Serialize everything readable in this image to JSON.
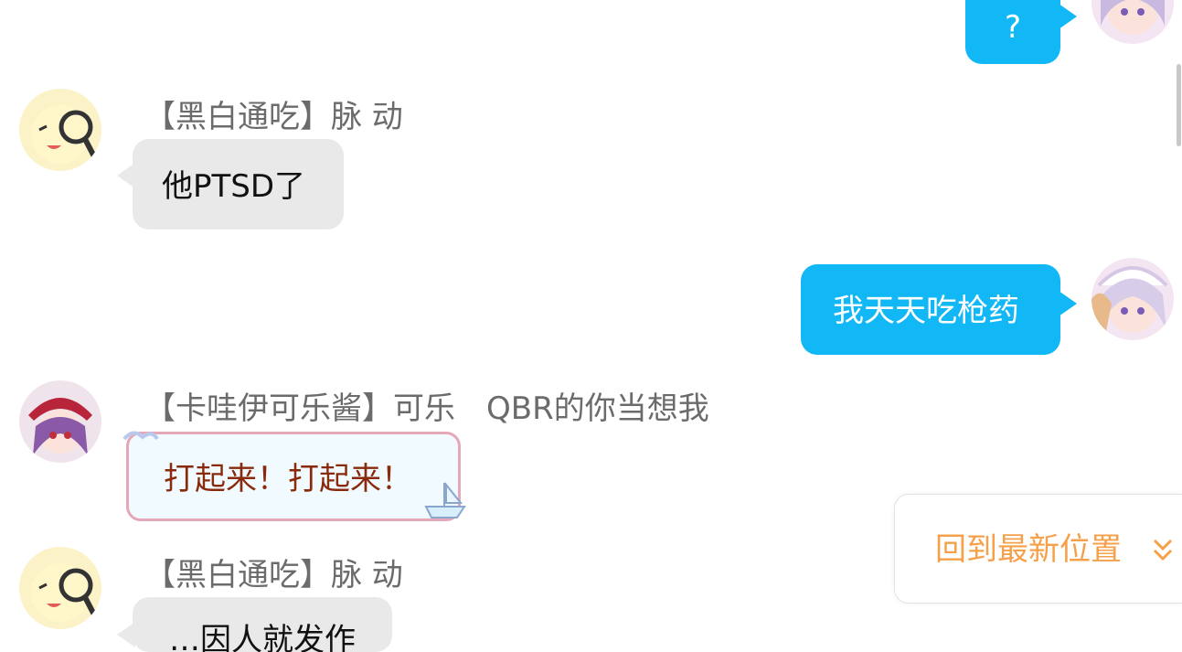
{
  "messages": [
    {
      "side": "right",
      "text": "?"
    },
    {
      "side": "left",
      "sender": "【黑白通吃】脉 动",
      "text": "他PTSD了"
    },
    {
      "side": "right",
      "text": "我天天吃枪药"
    },
    {
      "side": "left",
      "sender": "【卡哇伊可乐酱】可乐　QBR的你当想我",
      "text": "打起来！打起来！"
    },
    {
      "side": "left",
      "sender": "【黑白通吃】脉 动",
      "text": "…因人就发作"
    }
  ],
  "back_to_latest": {
    "label": "回到最新位置",
    "icon": "double-chevron-down-icon"
  },
  "colors": {
    "self_bubble": "#12b7f5",
    "other_bubble": "#e9e9e9",
    "accent": "#f5a04a"
  }
}
